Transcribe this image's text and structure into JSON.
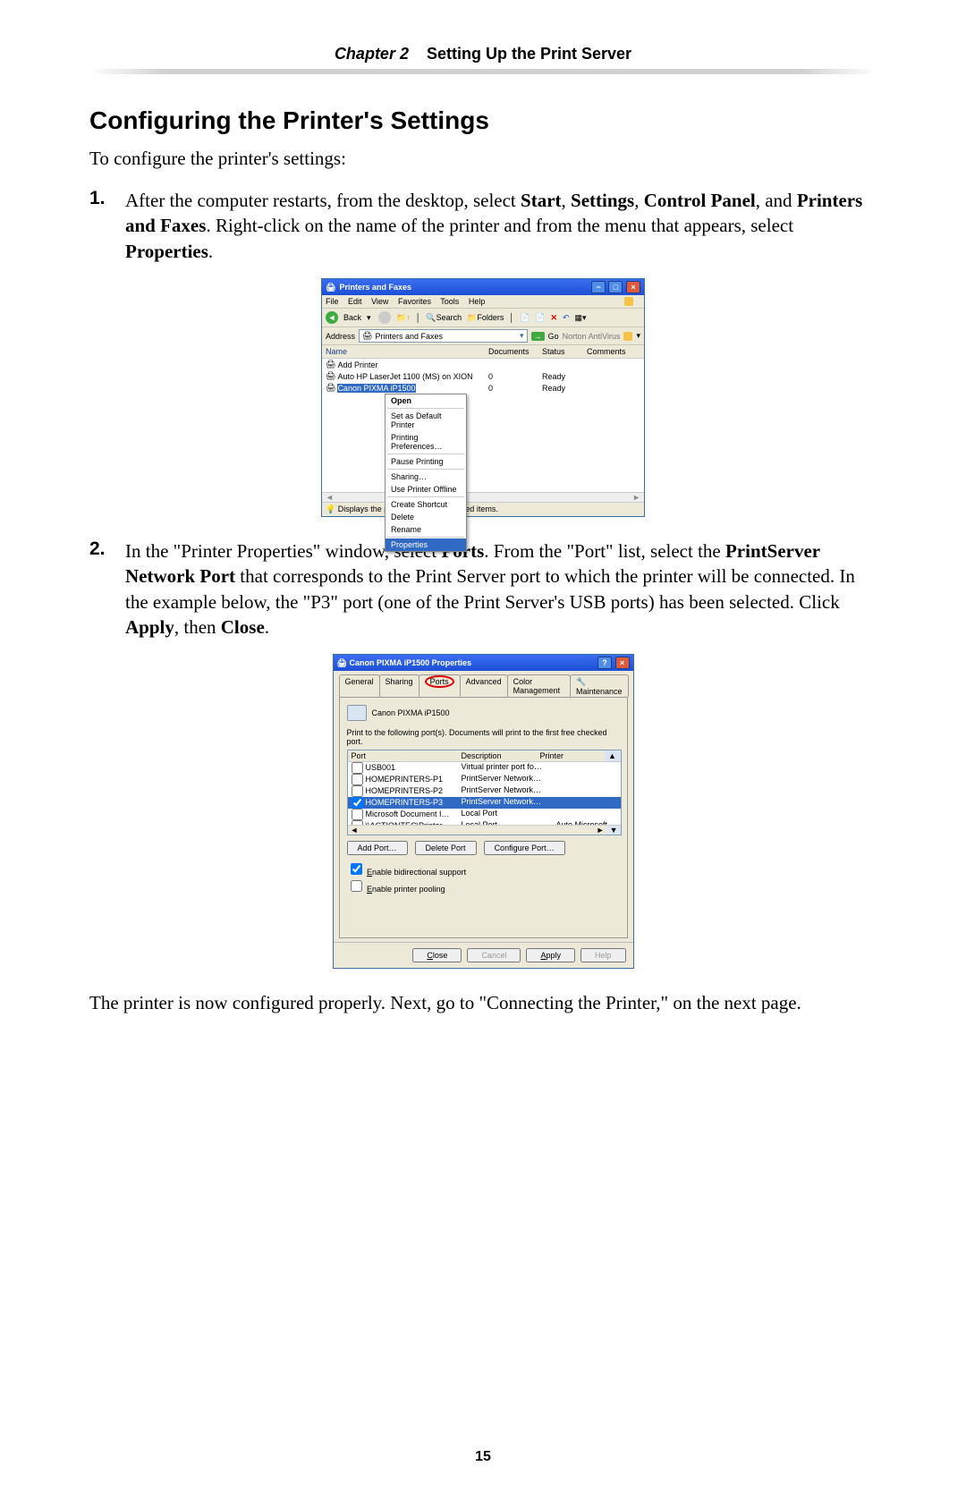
{
  "chapter": {
    "label": "Chapter 2",
    "title": "Setting Up the Print Server"
  },
  "section_title": "Configuring the Printer's Settings",
  "intro": "To configure the printer's settings:",
  "step1": {
    "num": "1.",
    "t1": "After the computer restarts, from the desktop, select ",
    "b1": "Start",
    "c1": ", ",
    "b2": "Settings",
    "c2": ", ",
    "b3": "Control Panel",
    "c3": ", and ",
    "b4": "Printers and Faxes",
    "t2": ". Right-click on the name of the printer and from the menu that appears, select ",
    "b5": "Properties",
    "t3": "."
  },
  "win1": {
    "title": "Printers and Faxes",
    "menu": [
      "File",
      "Edit",
      "View",
      "Favorites",
      "Tools",
      "Help"
    ],
    "back": "Back",
    "search": "Search",
    "folders": "Folders",
    "addr_label": "Address",
    "addr_val": "Printers and Faxes",
    "go": "Go",
    "norton": "Norton AntiVirus",
    "cols": {
      "name": "Name",
      "docs": "Documents",
      "status": "Status",
      "comments": "Comments"
    },
    "rows": [
      {
        "name": "Add Printer",
        "docs": "",
        "status": ""
      },
      {
        "name": "Auto HP LaserJet 1100 (MS) on XION",
        "docs": "0",
        "status": "Ready"
      },
      {
        "name": "Canon PIXMA iP1500",
        "docs": "0",
        "status": "Ready"
      }
    ],
    "ctx": {
      "open": "Open",
      "setdef": "Set as Default Printer",
      "prefs": "Printing Preferences…",
      "pause": "Pause Printing",
      "sharing": "Sharing…",
      "offline": "Use Printer Offline",
      "shortcut": "Create Shortcut",
      "del": "Delete",
      "rename": "Rename",
      "props": "Properties"
    },
    "status_bar": "Displays the properties of the selected items."
  },
  "step2": {
    "num": "2.",
    "t1": "In the \"Printer Properties\" window, select ",
    "b1": "Ports",
    "t2": ". From the \"Port\" list, select the ",
    "b2": "PrintServer Network Port",
    "t3": " that corresponds to the Print Server port to which the printer will be connected. In the example below, the \"P3\" port (one of the Print Server's ",
    "sc": "USB",
    "t4": " ports) has been selected. Click ",
    "b3": "Apply",
    "c1": ", then ",
    "b4": "Close",
    "t5": "."
  },
  "dlg": {
    "title": "Canon PIXMA iP1500 Properties",
    "tabs": {
      "general": "General",
      "sharing": "Sharing",
      "ports": "Ports",
      "advanced": "Advanced",
      "color": "Color Management",
      "maint": "Maintenance"
    },
    "printer": "Canon PIXMA iP1500",
    "print_to": "Print to the following port(s). Documents will print to the first free checked port.",
    "cols": {
      "port": "Port",
      "desc": "Description",
      "printer": "Printer"
    },
    "rows": [
      {
        "chk": false,
        "port": "USB001",
        "desc": "Virtual printer port fo…",
        "printer": ""
      },
      {
        "chk": false,
        "port": "HOMEPRINTERS-P1",
        "desc": "PrintServer Network…",
        "printer": ""
      },
      {
        "chk": false,
        "port": "HOMEPRINTERS-P2",
        "desc": "PrintServer Network…",
        "printer": ""
      },
      {
        "chk": true,
        "port": "HOMEPRINTERS-P3",
        "desc": "PrintServer Network…",
        "printer": "",
        "sel": true
      },
      {
        "chk": false,
        "port": "Microsoft Document I…",
        "desc": "Local Port",
        "printer": ""
      },
      {
        "chk": false,
        "port": "\\\\ACTIONTEC\\Printer",
        "desc": "Local Port",
        "printer": "Auto Microsoft "
      }
    ],
    "btns": {
      "add": "Add Port…",
      "del": "Delete Port",
      "cfg": "Configure Port…"
    },
    "check1": "Enable bidirectional support",
    "check2": "Enable printer pooling",
    "dlg_btns": {
      "close": "Close",
      "cancel": "Cancel",
      "apply": "Apply",
      "help": "Help"
    }
  },
  "conclusion": "The printer is now configured properly. Next, go to \"Connecting the Printer,\" on the next page.",
  "page_num": "15"
}
